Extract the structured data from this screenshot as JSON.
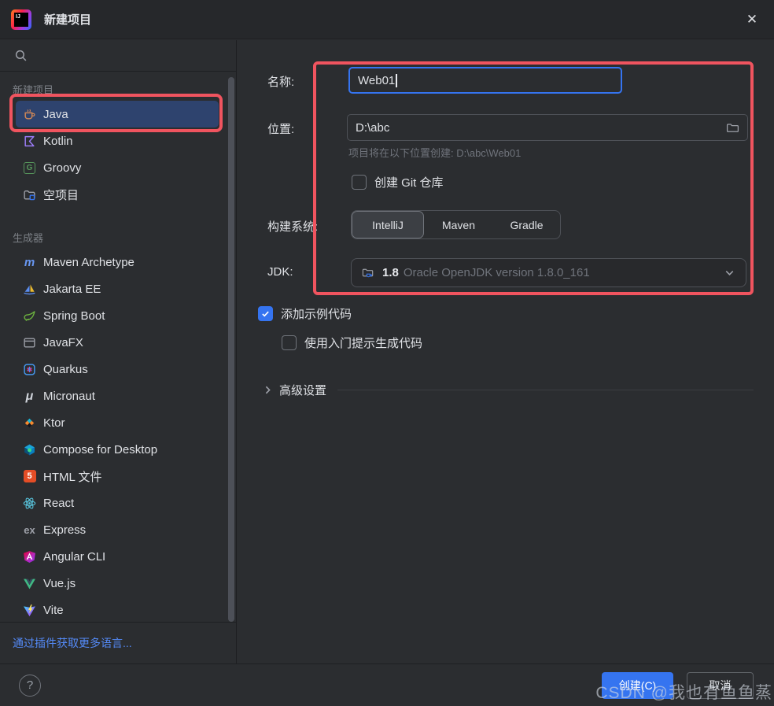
{
  "titlebar": {
    "title": "新建项目"
  },
  "sidebar": {
    "projects_header": "新建项目",
    "projects": [
      {
        "label": "Java",
        "icon": "java-icon",
        "selected": true
      },
      {
        "label": "Kotlin",
        "icon": "kotlin-icon",
        "selected": false
      },
      {
        "label": "Groovy",
        "icon": "groovy-icon",
        "selected": false
      },
      {
        "label": "空项目",
        "icon": "empty-project-icon",
        "selected": false
      }
    ],
    "generators_header": "生成器",
    "generators": [
      {
        "label": "Maven Archetype",
        "icon": "maven-icon"
      },
      {
        "label": "Jakarta EE",
        "icon": "jakarta-ee-icon"
      },
      {
        "label": "Spring Boot",
        "icon": "spring-boot-icon"
      },
      {
        "label": "JavaFX",
        "icon": "javafx-icon"
      },
      {
        "label": "Quarkus",
        "icon": "quarkus-icon"
      },
      {
        "label": "Micronaut",
        "icon": "micronaut-icon"
      },
      {
        "label": "Ktor",
        "icon": "ktor-icon"
      },
      {
        "label": "Compose for Desktop",
        "icon": "compose-desktop-icon"
      },
      {
        "label": "HTML 文件",
        "icon": "html5-icon"
      },
      {
        "label": "React",
        "icon": "react-icon"
      },
      {
        "label": "Express",
        "icon": "express-icon"
      },
      {
        "label": "Angular CLI",
        "icon": "angular-icon"
      },
      {
        "label": "Vue.js",
        "icon": "vue-icon"
      },
      {
        "label": "Vite",
        "icon": "vite-icon"
      }
    ],
    "more_link": "通过插件获取更多语言..."
  },
  "form": {
    "name_label": "名称:",
    "name_value": "Web01",
    "location_label": "位置:",
    "location_value": "D:\\abc",
    "location_hint": "项目将在以下位置创建: D:\\abc\\Web01",
    "git_checkbox_label": "创建 Git 仓库",
    "git_checked": false,
    "build_label": "构建系统:",
    "build_options": [
      "IntelliJ",
      "Maven",
      "Gradle"
    ],
    "build_selected": "IntelliJ",
    "jdk_label": "JDK:",
    "jdk_version": "1.8",
    "jdk_detail": "Oracle OpenJDK version 1.8.0_161",
    "sample_code_label": "添加示例代码",
    "sample_code_checked": true,
    "onboarding_label": "使用入门提示生成代码",
    "onboarding_checked": false,
    "advanced_label": "高级设置"
  },
  "footer": {
    "help_glyph": "?",
    "create_label": "创建(C)",
    "cancel_label": "取消"
  },
  "glyphs": {
    "maven": "m",
    "micronaut": "μ",
    "express": "ex",
    "groovy": "G",
    "html5": "5",
    "close": "✕",
    "logo": "IJ"
  },
  "watermark": "CSDN @我也有鱼鱼蒸",
  "colors": {
    "accent_blue": "#3574f0",
    "annotation_red": "#f0545f",
    "selection_blue": "#2e436e",
    "link_blue": "#548af7",
    "panel_bg": "#2b2d30"
  }
}
